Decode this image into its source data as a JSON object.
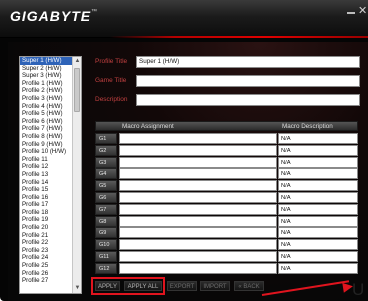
{
  "window": {
    "logo": "GIGABYTE",
    "logo_mark": "™",
    "close_glyph": "✕"
  },
  "profile_list": {
    "items": [
      "Super 1 (H/W)",
      "Super 2 (H/W)",
      "Super 3 (H/W)",
      "Profile 1 (H/W)",
      "Profile 2 (H/W)",
      "Profile 3 (H/W)",
      "Profile 4 (H/W)",
      "Profile 5 (H/W)",
      "Profile 6 (H/W)",
      "Profile 7 (H/W)",
      "Profile 8 (H/W)",
      "Profile 9 (H/W)",
      "Profile 10 (H/W)",
      "Profile 11",
      "Profile 12",
      "Profile 13",
      "Profile 14",
      "Profile 15",
      "Profile 16",
      "Profile 17",
      "Profile 18",
      "Profile 19",
      "Profile 20",
      "Profile 21",
      "Profile 22",
      "Profile 23",
      "Profile 24",
      "Profile 25",
      "Profile 26",
      "Profile 27"
    ],
    "selected_index": 0,
    "scroll_up": "▲",
    "scroll_down": "▼"
  },
  "fields": {
    "profile_title_label": "Profile Title",
    "profile_title_value": "Super 1 (H/W)",
    "game_title_label": "Game Title",
    "game_title_value": "",
    "description_label": "Description",
    "description_value": ""
  },
  "macro_table": {
    "header_assignment": "Macro Assignment",
    "header_description": "Macro Description",
    "rows": [
      {
        "key": "G1",
        "assignment": "",
        "description": "N/A"
      },
      {
        "key": "G2",
        "assignment": "",
        "description": "N/A"
      },
      {
        "key": "G3",
        "assignment": "",
        "description": "N/A"
      },
      {
        "key": "G4",
        "assignment": "",
        "description": "N/A"
      },
      {
        "key": "G5",
        "assignment": "",
        "description": "N/A"
      },
      {
        "key": "G6",
        "assignment": "",
        "description": "N/A"
      },
      {
        "key": "G7",
        "assignment": "",
        "description": "N/A"
      },
      {
        "key": "G8",
        "assignment": "",
        "description": "N/A"
      },
      {
        "key": "G9",
        "assignment": "",
        "description": "N/A"
      },
      {
        "key": "G10",
        "assignment": "",
        "description": "N/A"
      },
      {
        "key": "G11",
        "assignment": "",
        "description": "N/A"
      },
      {
        "key": "G12",
        "assignment": "",
        "description": "N/A"
      }
    ]
  },
  "buttons": {
    "apply": "APPLY",
    "apply_all": "APPLY ALL",
    "export": "EXPORT",
    "import": "IMPORT",
    "back": "« BACK"
  },
  "callout": {
    "text": "U",
    "color": "#e0141e"
  }
}
